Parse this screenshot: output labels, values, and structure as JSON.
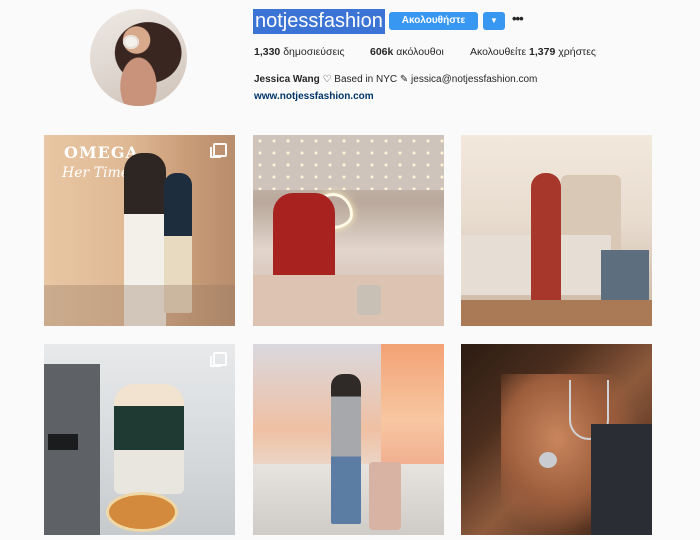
{
  "profile": {
    "username": "notjessfashion",
    "follow_label": "Ακολουθήστε",
    "dropdown_icon": "chevron-down-icon",
    "more_icon": "more-options-icon",
    "more_glyph": "•••"
  },
  "stats": {
    "posts_count": "1,330",
    "posts_label": "δημοσιεύσεις",
    "followers_count": "606k",
    "followers_label": "ακόλουθοι",
    "following_prefix": "Ακολουθείτε",
    "following_count": "1,379",
    "following_label": "χρήστες"
  },
  "bio": {
    "name": "Jessica Wang",
    "text": "♡ Based in NYC ✎ jessica@notjessfashion.com",
    "website": "www.notjessfashion.com"
  },
  "posts": [
    {
      "overlay_title": "OMEGA",
      "overlay_sub": "Her Time",
      "multi": true
    },
    {
      "multi": false
    },
    {
      "multi": false
    },
    {
      "multi": true
    },
    {
      "multi": false
    },
    {
      "multi": false
    }
  ],
  "colors": {
    "follow_button": "#3897f0",
    "username_highlight": "#3c74d6",
    "link": "#003569"
  }
}
